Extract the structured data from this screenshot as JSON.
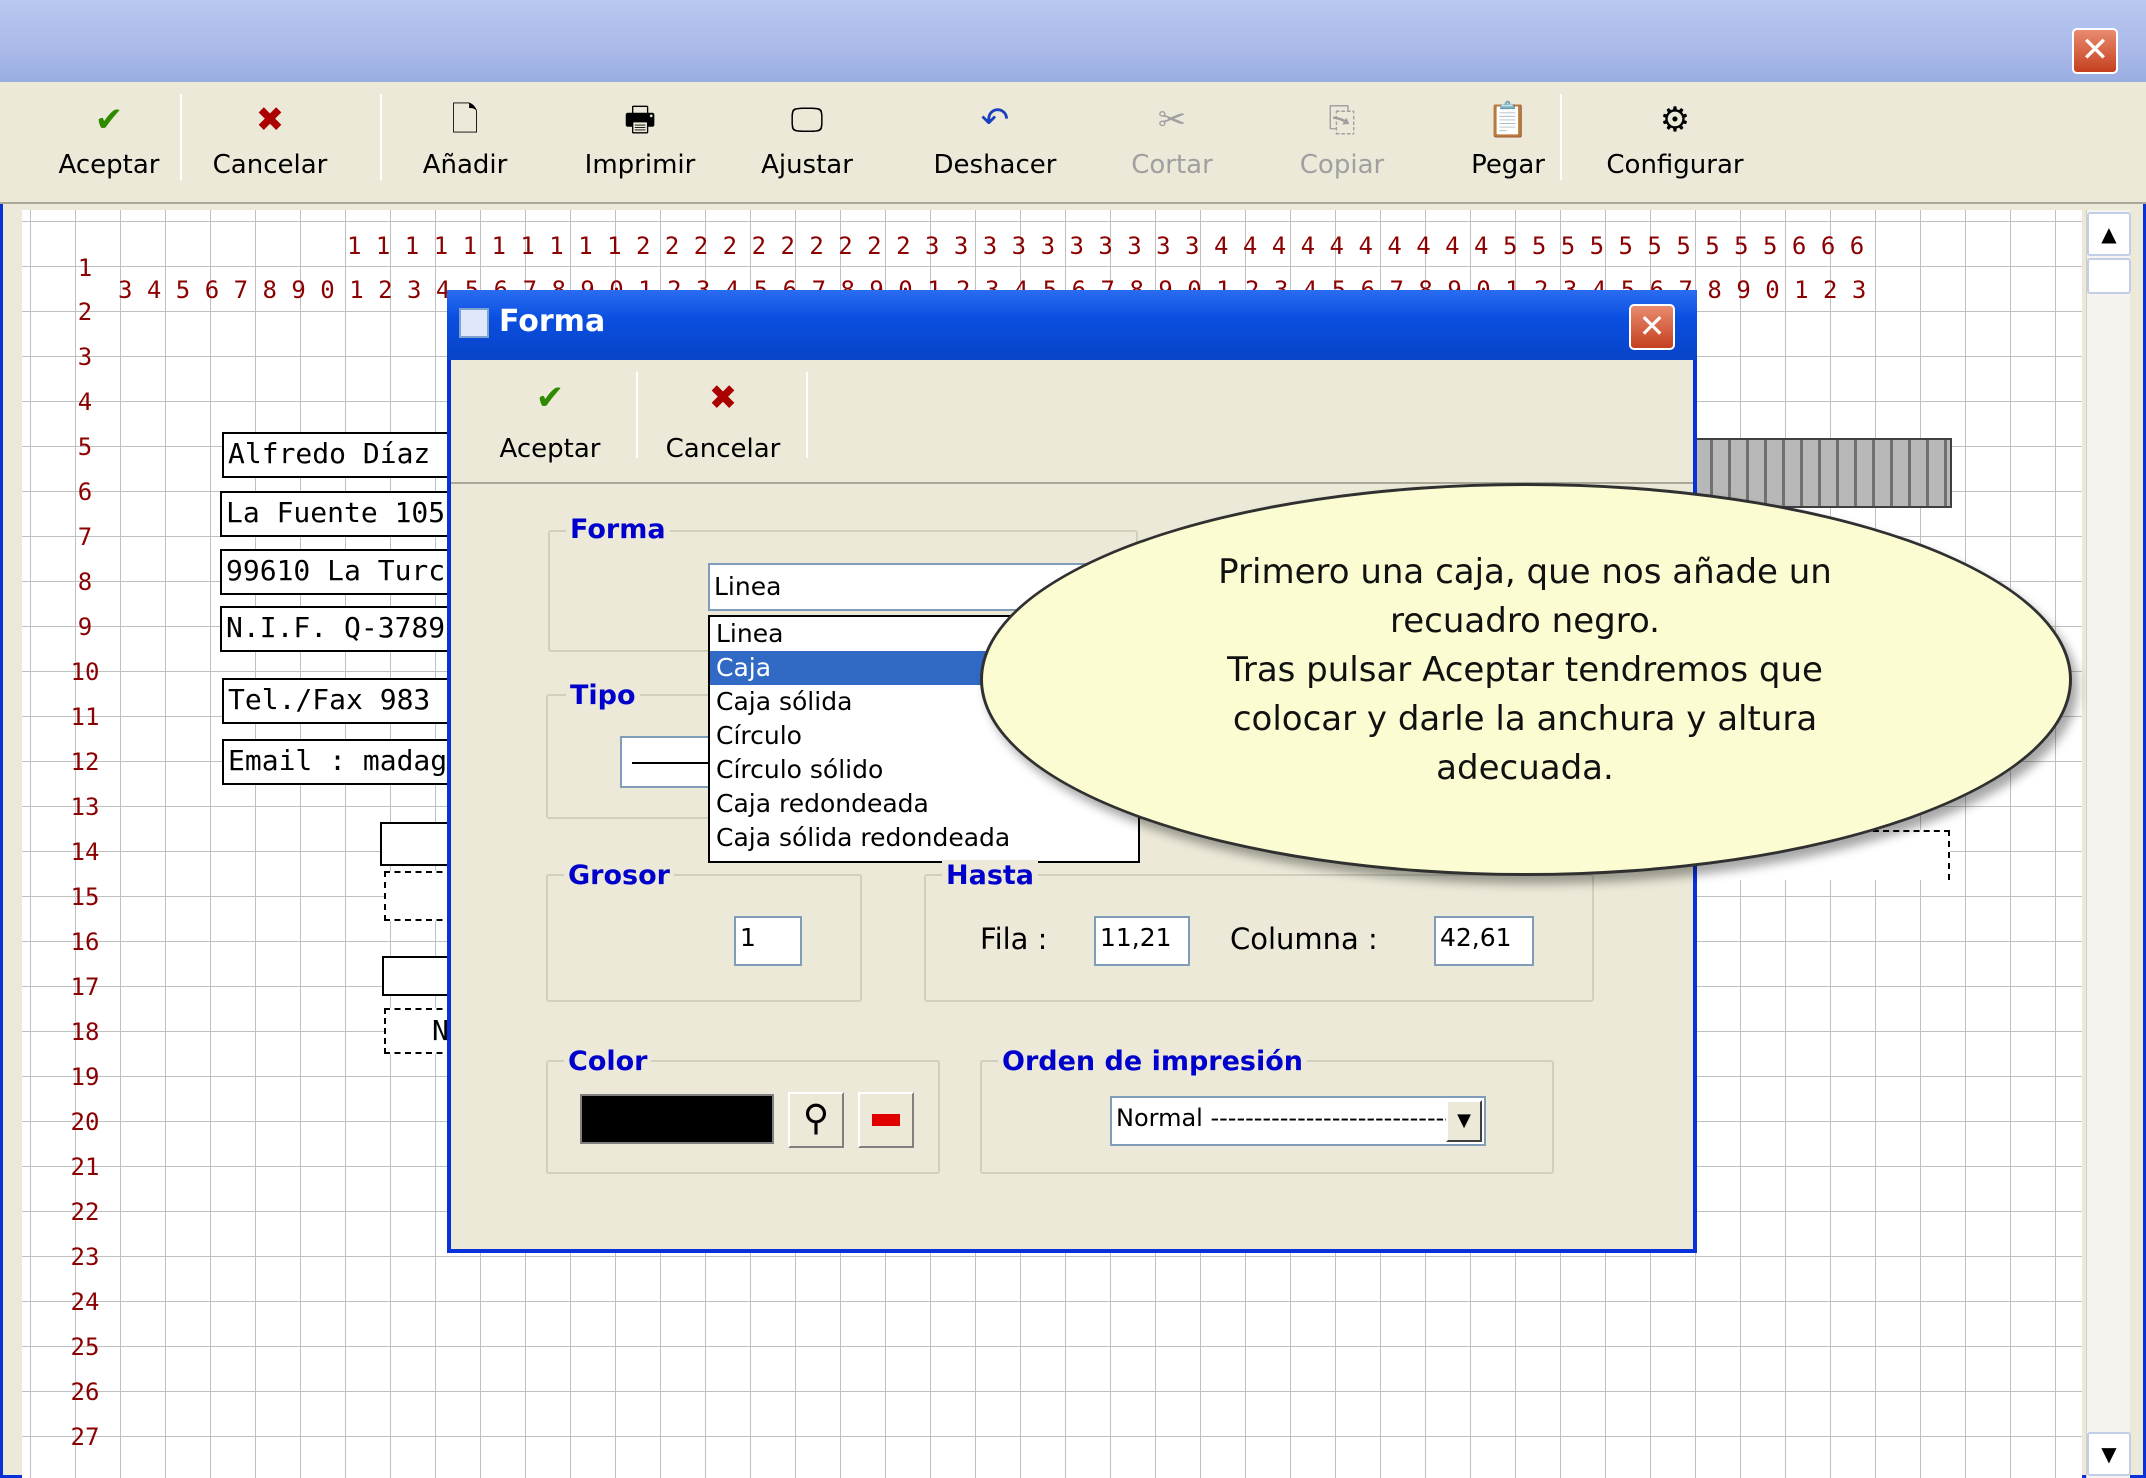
{
  "window": {
    "close_glyph": "✕"
  },
  "toolbar": [
    {
      "label": "Aceptar",
      "icon": "✔",
      "color": "#2e8b00",
      "disabled": false
    },
    {
      "label": "Cancelar",
      "icon": "✖",
      "color": "#aa0000",
      "disabled": false
    },
    {
      "label": "Añadir",
      "icon": "🗋",
      "color": "#000000",
      "disabled": false
    },
    {
      "label": "Imprimir",
      "icon": "🖶",
      "color": "#000000",
      "disabled": false
    },
    {
      "label": "Ajustar",
      "icon": "🖵",
      "color": "#000000",
      "disabled": false
    },
    {
      "label": "Deshacer",
      "icon": "↶",
      "color": "#1a3fbf",
      "disabled": false
    },
    {
      "label": "Cortar",
      "icon": "✂",
      "color": "#a0a0a0",
      "disabled": true
    },
    {
      "label": "Copiar",
      "icon": "⎘",
      "color": "#a0a0a0",
      "disabled": true
    },
    {
      "label": "Pegar",
      "icon": "📋",
      "color": "#000000",
      "disabled": false
    },
    {
      "label": "Configurar",
      "icon": "⚙",
      "color": "#000000",
      "disabled": false
    }
  ],
  "ruler": {
    "top_row": "1 1 1 1 1 1 1 1 1 1 2 2 2 2 2 2 2 2 2 2 3 3 3 3 3 3 3 3 3 3 4 4 4 4 4 4 4 4 4 4 5 5 5 5 5 5 5 5 5 5 6 6 6",
    "bottom_row": "3 4 5 6 7 8 9 0 1 2 3 4 5 6 7 8 9 0 1 2 3 4 5 6 7 8 9 0 1 2 3 4 5 6 7 8 9 0 1 2 3 4 5 6 7 8 9 0 1 2 3 4 5 6 7 8 9 0 1 2 3",
    "first_col_label": "1",
    "rows": [
      "2",
      "3",
      "4",
      "5",
      "6",
      "7",
      "8",
      "9",
      "10",
      "11",
      "12",
      "13",
      "14",
      "15",
      "16",
      "17",
      "18",
      "19",
      "20",
      "21",
      "22",
      "23",
      "24",
      "25",
      "26",
      "27"
    ]
  },
  "fields": [
    "Alfredo Díaz",
    "La Fuente 105",
    "99610 La Turc",
    "N.I.F. Q-3789",
    "Tel./Fax 983",
    "Email : madaga"
  ],
  "partial_field": "N",
  "dialog": {
    "title": "Forma",
    "close_glyph": "✕",
    "accept_label": "Aceptar",
    "cancel_label": "Cancelar",
    "forma_group": "Forma",
    "forma_value": "Linea",
    "tipo_group": "Tipo",
    "options": [
      "Linea",
      "Caja",
      "Caja sólida",
      "Círculo",
      "Círculo sólido",
      "Caja redondeada",
      "Caja sólida redondeada"
    ],
    "selected_option": "Caja",
    "grosor_group": "Grosor",
    "grosor_value": "1",
    "hasta_group": "Hasta",
    "fila_label": "Fila :",
    "fila_value": "11,21",
    "columna_label": "Columna :",
    "columna_value": "42,61",
    "color_group": "Color",
    "color_value": "#000000",
    "orden_group": "Orden de impresión",
    "orden_value": "Normal ------------------------------"
  },
  "callout": {
    "lines": [
      "Primero una caja, que nos añade un",
      "recuadro negro.",
      "Tras pulsar Aceptar tendremos que",
      "colocar y darle la anchura y altura",
      "adecuada."
    ]
  }
}
